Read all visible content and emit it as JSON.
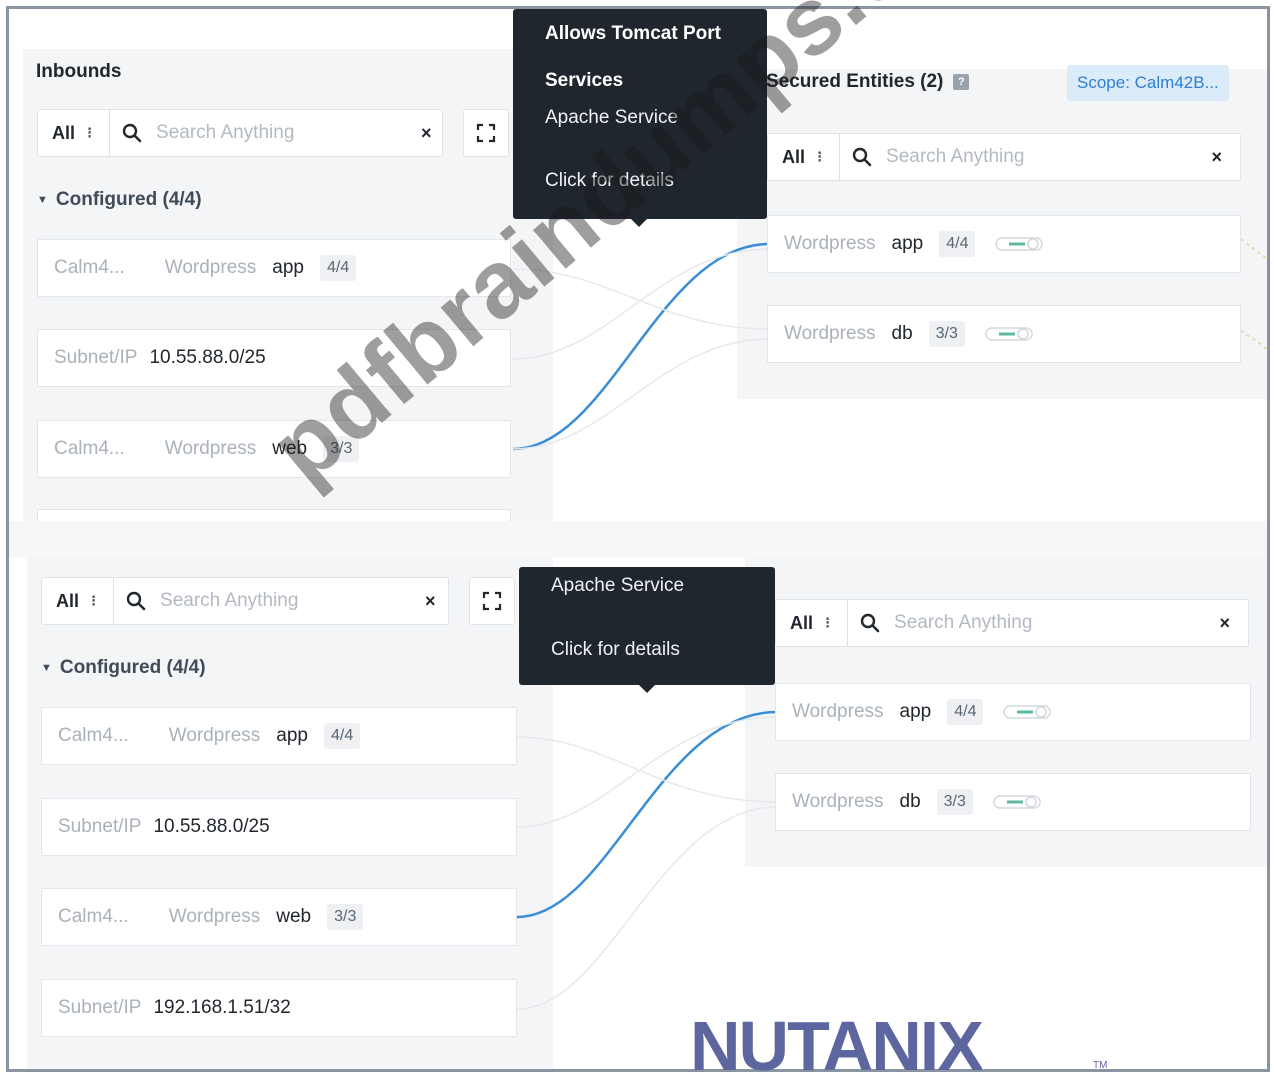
{
  "colors": {
    "link_line": "#3a8dd6",
    "tooltip_bg": "#20262e",
    "scope_bg": "#dcebfa",
    "scope_text": "#2d7fd3",
    "logo": "#5d669e"
  },
  "top": {
    "inbounds_title": "Inbounds",
    "search": {
      "filter": "All",
      "placeholder": "Search Anything"
    },
    "group": "Configured (4/4)",
    "inbound_rows": [
      {
        "col1": "Calm4...",
        "col2": "Wordpress",
        "col3": "app",
        "count": "4/4"
      },
      {
        "label": "Subnet/IP",
        "ip": "10.55.88.0/25"
      },
      {
        "col1": "Calm4...",
        "col2": "Wordpress",
        "col3": "web",
        "count": "3/3"
      }
    ],
    "tooltip": {
      "line1": "Allows Tomcat Port",
      "line2": "Services",
      "line3": "Apache Service",
      "line4": "Click for details"
    },
    "secured_title": "Secured Entities (2)",
    "help_icon": "?",
    "scope": "Scope: Calm42B...",
    "secured_search": {
      "filter": "All",
      "placeholder": "Search Anything"
    },
    "secured_rows": [
      {
        "col1": "Wordpress",
        "col2": "app",
        "count": "4/4"
      },
      {
        "col1": "Wordpress",
        "col2": "db",
        "count": "3/3"
      }
    ]
  },
  "bottom": {
    "search": {
      "filter": "All",
      "placeholder": "Search Anything"
    },
    "group": "Configured (4/4)",
    "inbound_rows": [
      {
        "col1": "Calm4...",
        "col2": "Wordpress",
        "col3": "app",
        "count": "4/4"
      },
      {
        "label": "Subnet/IP",
        "ip": "10.55.88.0/25"
      },
      {
        "col1": "Calm4...",
        "col2": "Wordpress",
        "col3": "web",
        "count": "3/3"
      },
      {
        "label": "Subnet/IP",
        "ip": "192.168.1.51/32"
      }
    ],
    "tooltip": {
      "line1": "Apache Service",
      "line2": "Click for details"
    },
    "secured_search": {
      "filter": "All",
      "placeholder": "Search Anything"
    },
    "secured_rows": [
      {
        "col1": "Wordpress",
        "col2": "app",
        "count": "4/4"
      },
      {
        "col1": "Wordpress",
        "col2": "db",
        "count": "3/3"
      }
    ]
  },
  "watermark": "pdfbraindumps.com",
  "logo": "NUTANIX",
  "logo_tm": "TM"
}
